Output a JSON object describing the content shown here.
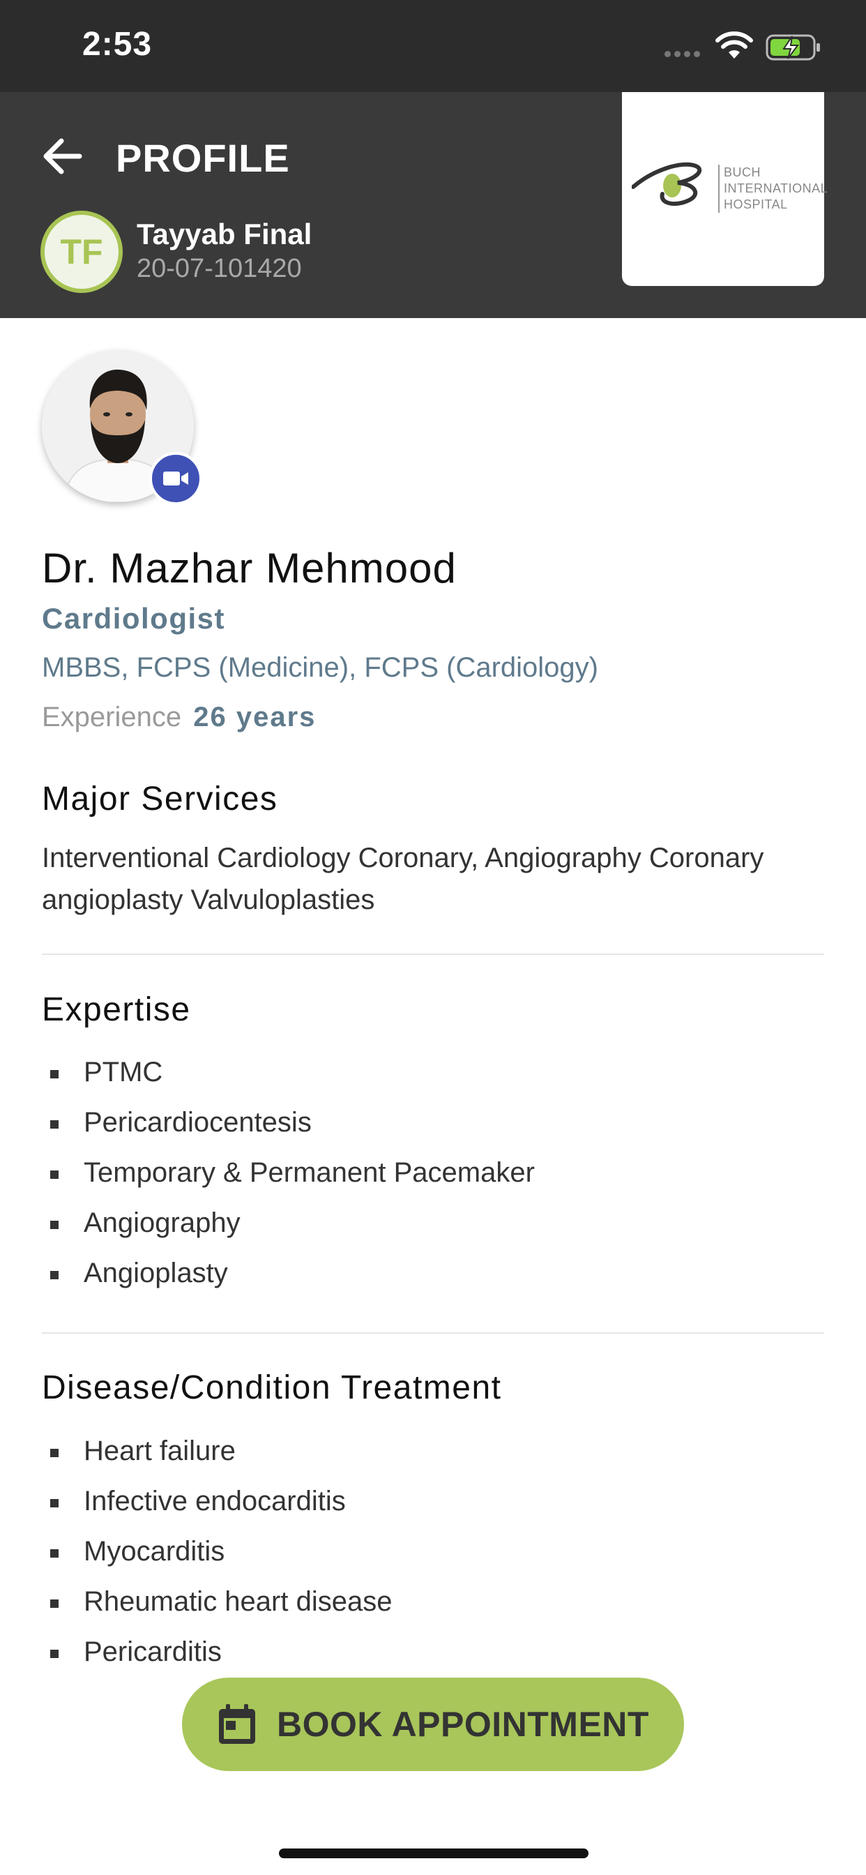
{
  "status_bar": {
    "time": "2:53"
  },
  "header": {
    "title": "PROFILE",
    "patient": {
      "initials": "TF",
      "name": "Tayyab Final",
      "id": "20-07-101420"
    },
    "hospital_logo": {
      "lines": [
        "BUCH",
        "INTERNATIONAL",
        "HOSPITAL"
      ]
    }
  },
  "doctor": {
    "name": "Dr. Mazhar Mehmood",
    "specialty": "Cardiologist",
    "qualifications": "MBBS, FCPS (Medicine), FCPS (Cardiology)",
    "experience_label": "Experience",
    "experience_value": "26 years"
  },
  "major_services": {
    "title": "Major Services",
    "text": "Interventional Cardiology Coronary, Angiography Coronary angioplasty Valvuloplasties"
  },
  "expertise": {
    "title": "Expertise",
    "items": [
      "PTMC",
      "Pericardiocentesis",
      "Temporary & Permanent Pacemaker",
      "Angiography",
      "Angioplasty"
    ]
  },
  "disease_treatment": {
    "title": "Disease/Condition Treatment",
    "items": [
      "Heart failure",
      "Infective endocarditis",
      "Myocarditis",
      "Rheumatic heart disease",
      "Pericarditis"
    ]
  },
  "book_button": {
    "label": "BOOK APPOINTMENT"
  },
  "colors": {
    "accent_green": "#a8c65a",
    "header_bg": "#3a3a3a",
    "status_bg": "#2c2c2c",
    "muted_blue": "#5f7a8c",
    "video_blue": "#3f51b5"
  }
}
